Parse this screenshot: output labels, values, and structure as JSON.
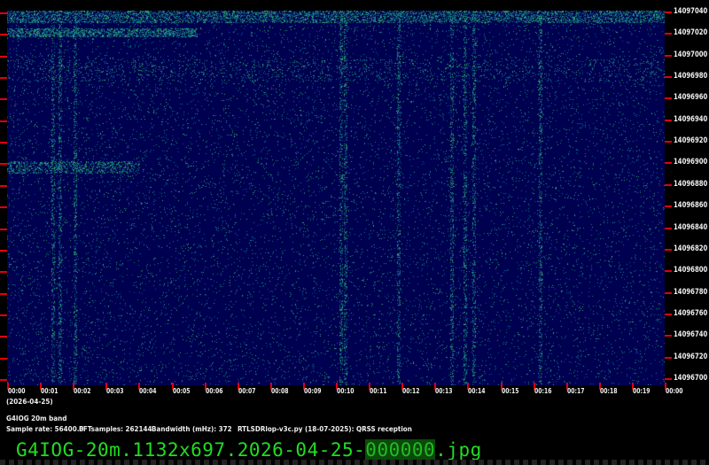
{
  "waterfall": {
    "background": "#000050",
    "signal_color": "#1e8a5a"
  },
  "y_axis": {
    "labels": [
      "14097040",
      "14097020",
      "14097000",
      "14096980",
      "14096960",
      "14096940",
      "14096920",
      "14096900",
      "14096880",
      "14096860",
      "14096840",
      "14096820",
      "14096800",
      "14096780",
      "14096760",
      "14096740",
      "14096720",
      "14096700"
    ]
  },
  "x_axis": {
    "labels": [
      "00:00",
      "00:01",
      "00:02",
      "00:03",
      "00:04",
      "00:05",
      "00:06",
      "00:07",
      "00:08",
      "00:09",
      "00:10",
      "00:11",
      "00:12",
      "00:13",
      "00:14",
      "00:15",
      "00:16",
      "00:17",
      "00:18",
      "00:19",
      "00:00"
    ],
    "date": "(2026-04-25)"
  },
  "info": {
    "station": "G4IOG 20m band",
    "sample_rate": "Sample rate: 56400.0",
    "fft": "FFTsamples: 262144",
    "bandwidth": "Bandwidth (mHz): 372",
    "software": "RTLSDRlop-v3c.py (18-07-2025): QRSS reception"
  },
  "filename": {
    "prefix": "G4IOG-20m.1132x697.2026-04-25-",
    "highlight": "000000",
    "suffix": ".jpg"
  }
}
